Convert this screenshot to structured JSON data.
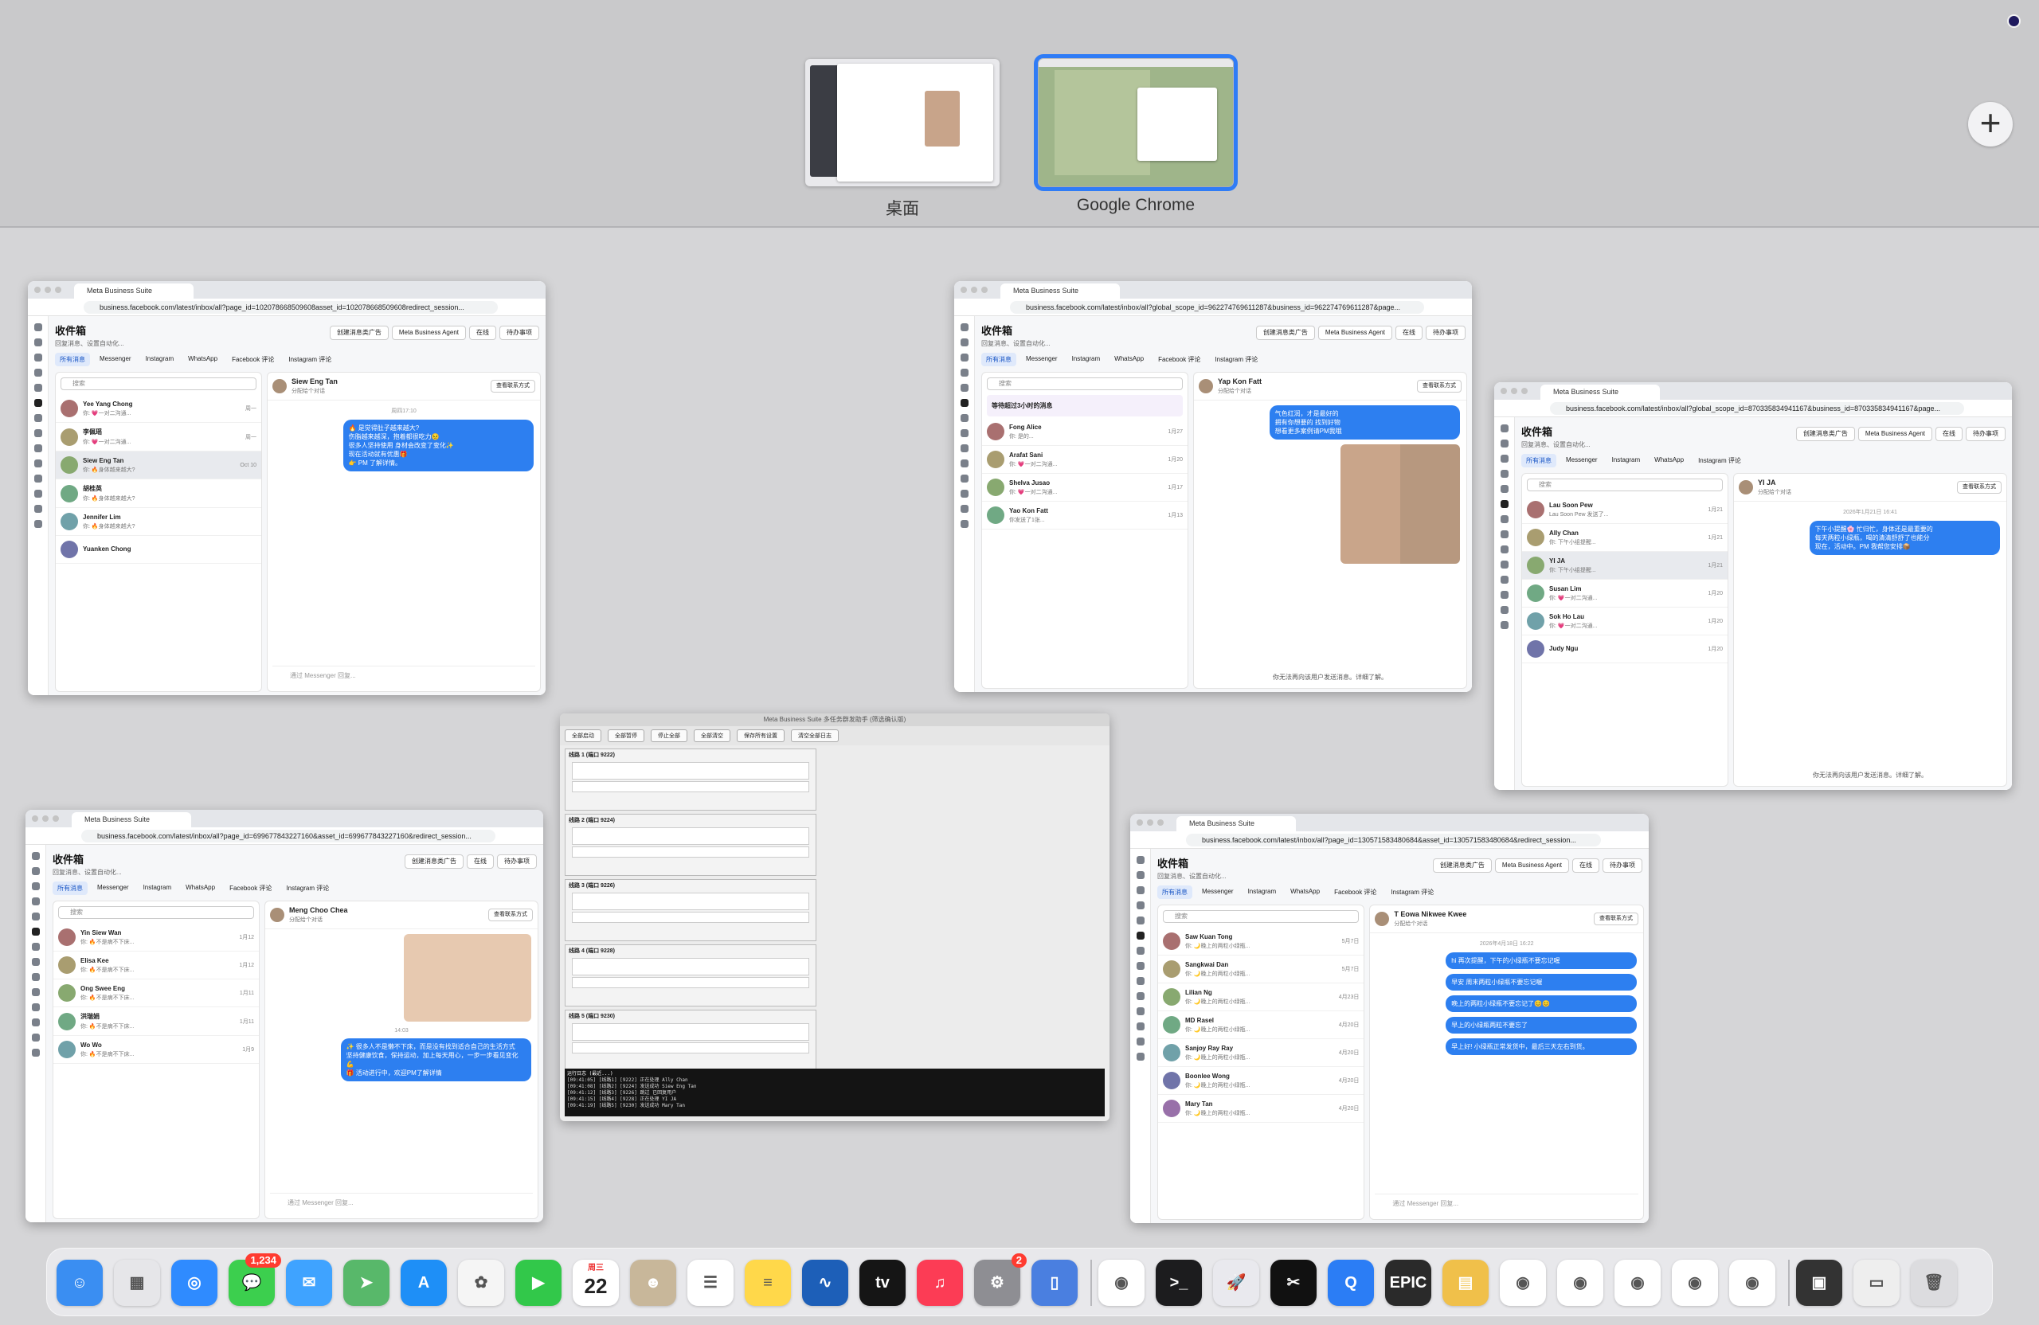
{
  "spaces": [
    {
      "label": "桌面",
      "active": false
    },
    {
      "label": "Google Chrome",
      "active": true
    }
  ],
  "add_space": "+",
  "windows": [
    {
      "tab": "Meta Business Suite",
      "url": "business.facebook.com/latest/inbox/all?page_id=102078668509608asset_id=102078668509608redirect_session...",
      "title": "收件箱",
      "subtitle": "回复消息、设置自动化...",
      "header_buttons": [
        "创建消息类广告",
        "Meta Business Agent",
        "在线",
        "待办事项"
      ],
      "tabs": [
        "所有消息",
        "Messenger",
        "Instagram",
        "WhatsApp",
        "Facebook 评论",
        "Instagram 评论"
      ],
      "search_placeholder": "搜索",
      "conversations": [
        {
          "name": "Yee Yang Chong",
          "snippet": "你: 💗一对二沟通...",
          "date": "周一"
        },
        {
          "name": "李佩瑶",
          "snippet": "你: 💗一对二沟通...",
          "date": "周一"
        },
        {
          "name": "Siew Eng Tan",
          "snippet": "你: 🔥身体越来越大?",
          "date": "Oct 10"
        },
        {
          "name": "胡桂英",
          "snippet": "你: 🔥身体越来越大?",
          "date": ""
        },
        {
          "name": "Jennifer Lim",
          "snippet": "你: 🔥身体越来越大?",
          "date": ""
        },
        {
          "name": "Yuanken Chong",
          "snippet": "",
          "date": ""
        }
      ],
      "contact": "Siew Eng Tan",
      "contact_sub": "分配给个对话",
      "view_button": "查看联系方式",
      "timestamp": "周四17:10",
      "messages": [
        "🔥 是觉得肚子越来越大?\n伤脂越来越深，抱着都很吃力😣\n很多人坚持使用 身材会改变了变化✨\n现在活动就有优惠🎁\n👉 PM 了解详情。"
      ],
      "composer": "通过 Messenger 回复..."
    },
    {
      "tab": "Meta Business Suite",
      "url": "business.facebook.com/latest/inbox/all?global_scope_id=962274769611287&business_id=962274769611287&page...",
      "title": "收件箱",
      "subtitle": "回复消息、设置自动化...",
      "header_buttons": [
        "创建消息类广告",
        "Meta Business Agent",
        "在线",
        "待办事项"
      ],
      "tabs": [
        "所有消息",
        "Messenger",
        "Instagram",
        "WhatsApp",
        "Facebook 评论",
        "Instagram 评论"
      ],
      "search_placeholder": "搜索",
      "banner": "等待超过3小时的消息",
      "conversations": [
        {
          "name": "Fong Alice",
          "snippet": "你: 是的...",
          "date": "1月27"
        },
        {
          "name": "Arafat Sani",
          "snippet": "你: 💗一对二沟通...",
          "date": "1月20"
        },
        {
          "name": "Shelva Jusao",
          "snippet": "你: 💗一对二沟通...",
          "date": "1月17"
        },
        {
          "name": "Yao Kon Fatt",
          "snippet": "你发送了1张...",
          "date": "1月13"
        }
      ],
      "contact": "Yap Kon Fatt",
      "contact_sub": "分配给个对话",
      "view_button": "查看联系方式",
      "timestamp": "",
      "messages": [
        "气色红润，才是最好的\n拥有你想要的 找到好物\n想看更多案例请PM我哦"
      ],
      "notice": "你无法再向该用户发送消息。详细了解。",
      "composer": ""
    },
    {
      "tab": "Meta Business Suite",
      "url": "business.facebook.com/latest/inbox/all?global_scope_id=870335834941167&business_id=870335834941167&page...",
      "title": "收件箱",
      "subtitle": "回复消息、设置自动化...",
      "header_buttons": [
        "创建消息类广告",
        "Meta Business Agent",
        "在线",
        "待办事项"
      ],
      "tabs": [
        "所有消息",
        "Messenger",
        "Instagram",
        "WhatsApp",
        "Instagram 评论"
      ],
      "search_placeholder": "搜索",
      "conversations": [
        {
          "name": "Lau Soon Pew",
          "snippet": "Lau Soon Pew 发送了...",
          "date": "1月21"
        },
        {
          "name": "Ally Chan",
          "snippet": "你: 下午小组提醒...",
          "date": "1月21"
        },
        {
          "name": "YI JA",
          "snippet": "你: 下午小组提醒...",
          "date": "1月21"
        },
        {
          "name": "Susan Lim",
          "snippet": "你: 💗一对二沟通...",
          "date": "1月20"
        },
        {
          "name": "Sok Ho Lau",
          "snippet": "你: 💗一对二沟通...",
          "date": "1月20"
        },
        {
          "name": "Judy Ngu",
          "snippet": "",
          "date": "1月20"
        }
      ],
      "contact": "YI JA",
      "contact_sub": "分配给个对话",
      "view_button": "查看联系方式",
      "timestamp": "2026年1月21日 16:41",
      "messages": [
        "下午小提醒🌸 忙归忙，身体还是最重要的\n每天两粒小绿瓶，喝的清清舒舒了也能分\n现在，活动中。PM 我帮您安排📦"
      ],
      "notice": "你无法再向该用户发送消息。详细了解。",
      "composer": ""
    },
    {
      "tab": "Meta Business Suite",
      "url": "business.facebook.com/latest/inbox/all?page_id=699677843227160&asset_id=699677843227160&redirect_session...",
      "title": "收件箱",
      "subtitle": "回复消息、设置自动化...",
      "header_buttons": [
        "创建消息类广告",
        "在线",
        "待办事项"
      ],
      "tabs": [
        "所有消息",
        "Messenger",
        "Instagram",
        "WhatsApp",
        "Facebook 评论",
        "Instagram 评论"
      ],
      "search_placeholder": "搜索",
      "conversations": [
        {
          "name": "Yin Siew Wan",
          "snippet": "你: 🔥不是病不下床...",
          "date": "1月12"
        },
        {
          "name": "Elisa Kee",
          "snippet": "你: 🔥不是病不下床...",
          "date": "1月12"
        },
        {
          "name": "Ong Swee Eng",
          "snippet": "你: 🔥不是病不下床...",
          "date": "1月11"
        },
        {
          "name": "洪瑞娟",
          "snippet": "你: 🔥不是病不下床...",
          "date": "1月11"
        },
        {
          "name": "Wo Wo",
          "snippet": "你: 🔥不是病不下床...",
          "date": "1月9"
        }
      ],
      "contact": "Meng Choo Chea",
      "contact_sub": "分配给个对话",
      "view_button": "查看联系方式",
      "timestamp": "14:03",
      "messages": [
        "✨ 很多人不是懒不下床，而是没有找到适合自己的生活方式\n坚持健康饮食，保持运动，加上每天用心，一步一步看见变化 💪\n🎁 活动进行中，欢迎PM了解详情"
      ],
      "composer": "通过 Messenger 回复..."
    },
    {
      "tab": "Meta Business Suite",
      "url": "business.facebook.com/latest/inbox/all?page_id=130571583480684&asset_id=130571583480684&redirect_session...",
      "title": "收件箱",
      "subtitle": "回复消息、设置自动化...",
      "header_buttons": [
        "创建消息类广告",
        "Meta Business Agent",
        "在线",
        "待办事项"
      ],
      "tabs": [
        "所有消息",
        "Messenger",
        "Instagram",
        "WhatsApp",
        "Facebook 评论",
        "Instagram 评论"
      ],
      "search_placeholder": "搜索",
      "conversations": [
        {
          "name": "Saw Kuan Tong",
          "snippet": "你: 🌙晚上的两粒小绿瓶...",
          "date": "5月7日"
        },
        {
          "name": "Sangkwai Dan",
          "snippet": "你: 🌙晚上的两粒小绿瓶...",
          "date": "5月7日"
        },
        {
          "name": "Lilian Ng",
          "snippet": "你: 🌙晚上的两粒小绿瓶...",
          "date": "4月23日"
        },
        {
          "name": "MD Rasel",
          "snippet": "你: 🌙晚上的两粒小绿瓶...",
          "date": "4月20日"
        },
        {
          "name": "Sanjoy Ray Ray",
          "snippet": "你: 🌙晚上的两粒小绿瓶...",
          "date": "4月20日"
        },
        {
          "name": "Boonlee Wong",
          "snippet": "你: 🌙晚上的两粒小绿瓶...",
          "date": "4月20日"
        },
        {
          "name": "Mary Tan",
          "snippet": "你: 🌙晚上的两粒小绿瓶...",
          "date": "4月20日"
        }
      ],
      "contact": "T Eowa Nikwee Kwee",
      "contact_sub": "分配给个对话",
      "view_button": "查看联系方式",
      "timestamp": "2026年4月18日 16:22",
      "messages": [
        "hi 再次提醒，下午的小绿瓶不要忘记喔",
        "早安 周末两粒小绿瓶不要忘记喔",
        "晚上的两粒小绿瓶不要忘记了😊😊",
        "早上的小绿瓶两粒不要忘了",
        "早上好! 小绿瓶正常发货中，最后三天左右到货。"
      ],
      "composer": "通过 Messenger 回复..."
    }
  ],
  "tool": {
    "title": "Meta Business Suite 多任务群发助手 (筛选确认版)",
    "buttons": [
      "全部启动",
      "全部暂停",
      "停止全部",
      "全部清空",
      "保存所有设置",
      "清空全部日志"
    ],
    "groups": [
      "线路 1 (端口 9222)",
      "线路 2 (端口 9224)",
      "线路 3 (端口 9226)",
      "线路 4 (端口 9228)",
      "线路 5 (端口 9230)"
    ],
    "log_title": "运行日志 (最近...)",
    "log_lines": [
      "[09:41:05] [线路1] [9222] 正在处理 Ally Chan",
      "[09:41:08] [线路2] [9224] 发送成功 Siew Eng Tan",
      "[09:41:12] [线路3] [9226] 跳过 已回复用户",
      "[09:41:15] [线路4] [9228] 正在处理 YI JA",
      "[09:41:19] [线路5] [9230] 发送成功 Mary Tan"
    ]
  },
  "dock": {
    "messages_badge": "1,234",
    "settings_badge": "2",
    "calendar_weekday": "周三",
    "calendar_day": "22",
    "apps": [
      {
        "name": "finder-icon",
        "color": "#3a8ef2",
        "glyph": "☺"
      },
      {
        "name": "launchpad-icon",
        "color": "#e6e6e9",
        "glyph": "▦"
      },
      {
        "name": "safari-icon",
        "color": "#2f8bff",
        "glyph": "◎"
      },
      {
        "name": "messages-icon",
        "color": "#3ccf4e",
        "glyph": "💬"
      },
      {
        "name": "mail-icon",
        "color": "#3fa3ff",
        "glyph": "✉"
      },
      {
        "name": "maps-icon",
        "color": "#58b86a",
        "glyph": "➤"
      },
      {
        "name": "app-store-icon",
        "color": "#1e8ff7",
        "glyph": "A"
      },
      {
        "name": "photos-icon",
        "color": "#f5f5f5",
        "glyph": "✿"
      },
      {
        "name": "facetime-icon",
        "color": "#32c84a",
        "glyph": "▶"
      },
      {
        "name": "calendar-icon",
        "color": "#ffffff",
        "glyph": ""
      },
      {
        "name": "contacts-icon",
        "color": "#c8b79a",
        "glyph": "☻"
      },
      {
        "name": "reminders-icon",
        "color": "#ffffff",
        "glyph": "☰"
      },
      {
        "name": "notes-icon",
        "color": "#ffd84a",
        "glyph": "≡"
      },
      {
        "name": "freeform-icon",
        "color": "#1d5fb8",
        "glyph": "∿"
      },
      {
        "name": "apple-tv-icon",
        "color": "#151515",
        "glyph": "tv"
      },
      {
        "name": "music-icon",
        "color": "#fc3c55",
        "glyph": "♫"
      },
      {
        "name": "system-settings-icon",
        "color": "#8e8e93",
        "glyph": "⚙"
      },
      {
        "name": "simulator-icon",
        "color": "#4a7fe0",
        "glyph": "▯"
      },
      {
        "name": "chrome-icon",
        "color": "#ffffff",
        "glyph": "◉"
      },
      {
        "name": "terminal-icon",
        "color": "#1c1c1e",
        "glyph": ">_"
      },
      {
        "name": "rocket-icon",
        "color": "#e9e9ee",
        "glyph": "🚀"
      },
      {
        "name": "capcut-icon",
        "color": "#111111",
        "glyph": "✂"
      },
      {
        "name": "quickq-icon",
        "color": "#2b7df5",
        "glyph": "Q"
      },
      {
        "name": "epic-games-icon",
        "color": "#2a2a2a",
        "glyph": "EPIC"
      },
      {
        "name": "archive-icon",
        "color": "#f0c04a",
        "glyph": "▤"
      },
      {
        "name": "chrome-test-icon-1",
        "color": "#ffffff",
        "glyph": "◉"
      },
      {
        "name": "chrome-test-icon-2",
        "color": "#ffffff",
        "glyph": "◉"
      },
      {
        "name": "chrome-test-icon-3",
        "color": "#ffffff",
        "glyph": "◉"
      },
      {
        "name": "chrome-test-icon-4",
        "color": "#ffffff",
        "glyph": "◉"
      },
      {
        "name": "chrome-test-icon-5",
        "color": "#ffffff",
        "glyph": "◉"
      },
      {
        "name": "stack-folder-icon",
        "color": "#333333",
        "glyph": "▣"
      },
      {
        "name": "document-stack-icon",
        "color": "#eeeeee",
        "glyph": "▭"
      },
      {
        "name": "trash-icon",
        "color": "#dcdcdf",
        "glyph": "🗑"
      }
    ]
  }
}
